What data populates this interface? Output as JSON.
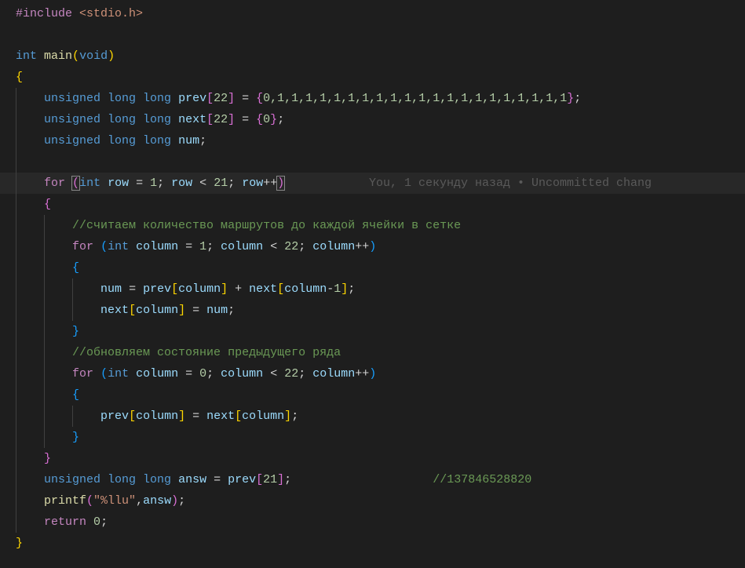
{
  "code": {
    "l1_inc": "#include",
    "l1_hdr": " <stdio.h>",
    "l3_int": "int",
    "l3_main": "main",
    "l3_void": "void",
    "l5_type": "unsigned long long",
    "l5_var": "prev",
    "l5_sz": "22",
    "l5_init": "0,1,1,1,1,1,1,1,1,1,1,1,1,1,1,1,1,1,1,1,1,1",
    "l6_var": "next",
    "l6_sz": "22",
    "l6_init": "0",
    "l7_var": "num",
    "l9_for": "for",
    "l9_int": "int",
    "l9_row": "row",
    "l9_eq1": "1",
    "l9_lt": "21",
    "l9_inc": "row",
    "l11_cmt": "//считаем количество маршрутов до каждой ячейки в сетке",
    "l12_for": "for",
    "l12_int": "int",
    "l12_col": "column",
    "l12_eq1": "1",
    "l12_lt": "22",
    "l14_num": "num",
    "l14_prev": "prev",
    "l14_col": "column",
    "l14_next": "next",
    "l14_col2": "column",
    "l14_minus1": "1",
    "l15_next": "next",
    "l15_col": "column",
    "l15_num": "num",
    "l17_cmt": "//обновляем состояние предыдущего ряда",
    "l18_for": "for",
    "l18_int": "int",
    "l18_col": "column",
    "l18_eq1": "0",
    "l18_lt": "22",
    "l20_prev": "prev",
    "l20_col": "column",
    "l20_next": "next",
    "l20_col2": "column",
    "l23_type": "unsigned long long",
    "l23_answ": "answ",
    "l23_prev": "prev",
    "l23_idx": "21",
    "l23_cmt": "//137846528820",
    "l24_printf": "printf",
    "l24_fmt": "\"%llu\"",
    "l24_answ": "answ",
    "l25_ret": "return",
    "l25_zero": "0"
  },
  "blame": {
    "text": "You, 1 секунду назад • Uncommitted chang"
  }
}
